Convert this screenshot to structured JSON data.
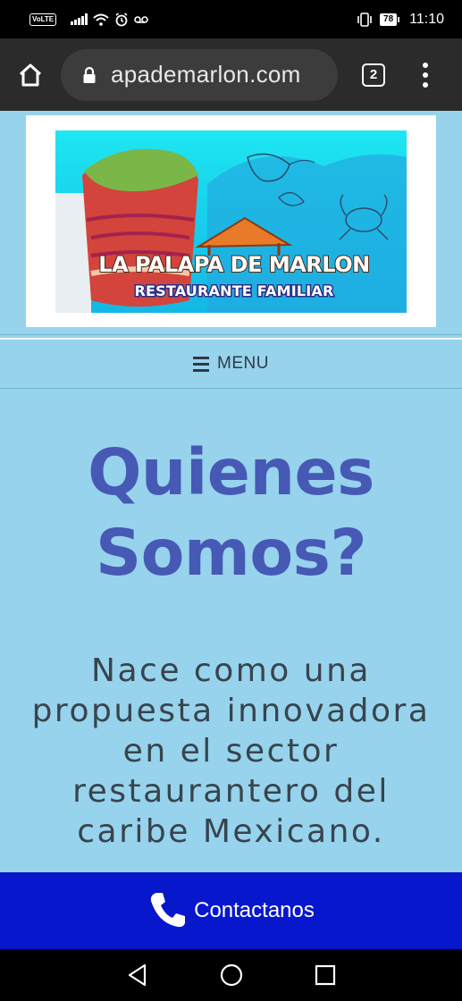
{
  "status_bar": {
    "volte": "VoLTE",
    "battery": "78",
    "time": "11:10",
    "icons": [
      "signal-icon",
      "wifi-icon",
      "alarm-icon",
      "voicemail-icon",
      "vibrate-icon",
      "battery-icon"
    ]
  },
  "browser": {
    "url": "apademarlon.com",
    "tab_count": "2",
    "icons": [
      "home-icon",
      "lock-icon",
      "tabs-icon",
      "more-icon"
    ]
  },
  "logo": {
    "name": "LA PALAPA DE MARLON",
    "tagline": "RESTAURANTE FAMILIAR"
  },
  "nav": {
    "menu_label": "MENU"
  },
  "main": {
    "heading_line1": "Quienes",
    "heading_line2": "Somos?",
    "body_lines": [
      "Nace como una",
      "propuesta innovadora",
      "en el sector",
      "restaurantero del",
      "caribe Mexicano."
    ]
  },
  "contact": {
    "label": "Contactanos"
  },
  "colors": {
    "page_bg": "#97d3ec",
    "heading": "#4659b4",
    "contact_bar": "#0717cc",
    "browser_bar": "#2b2b2b"
  }
}
